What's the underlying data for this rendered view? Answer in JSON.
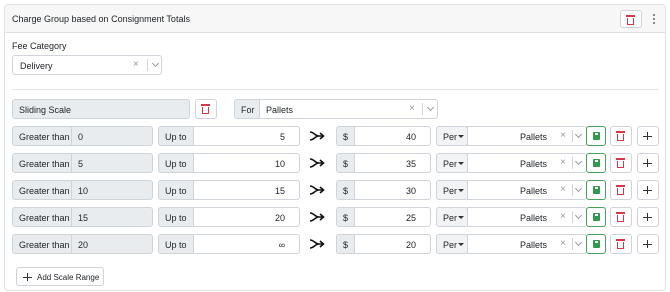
{
  "header": {
    "title": "Charge Group based on Consignment Totals"
  },
  "fee_category": {
    "label": "Fee Category",
    "value": "Delivery"
  },
  "scale": {
    "type_label": "Sliding Scale",
    "for_label": "For",
    "for_value": "Pallets"
  },
  "rows": [
    {
      "cond": "Greater than",
      "from": "0",
      "upto": "Up to",
      "to": "5",
      "currency": "$",
      "price": "40",
      "per": "Per",
      "unit": "Pallets"
    },
    {
      "cond": "Greater than",
      "from": "5",
      "upto": "Up to",
      "to": "10",
      "currency": "$",
      "price": "35",
      "per": "Per",
      "unit": "Pallets"
    },
    {
      "cond": "Greater than",
      "from": "10",
      "upto": "Up to",
      "to": "15",
      "currency": "$",
      "price": "30",
      "per": "Per",
      "unit": "Pallets"
    },
    {
      "cond": "Greater than",
      "from": "15",
      "upto": "Up to",
      "to": "20",
      "currency": "$",
      "price": "25",
      "per": "Per",
      "unit": "Pallets"
    },
    {
      "cond": "Greater than",
      "from": "20",
      "upto": "Up to",
      "to": "∞",
      "currency": "$",
      "price": "20",
      "per": "Per",
      "unit": "Pallets"
    }
  ],
  "add_range_label": "Add Scale Range",
  "icons": {
    "delete": "trash-icon",
    "menu": "dots-vertical-icon",
    "clear": "close-icon",
    "dropdown": "chevron-down-icon",
    "arrow": "merge-arrow-icon",
    "save": "save-icon",
    "add": "plus-icon"
  },
  "colors": {
    "danger": "#dc3545",
    "success": "#2f9a4c",
    "border": "#ced4da",
    "header_bg": "#f7f7f7"
  }
}
